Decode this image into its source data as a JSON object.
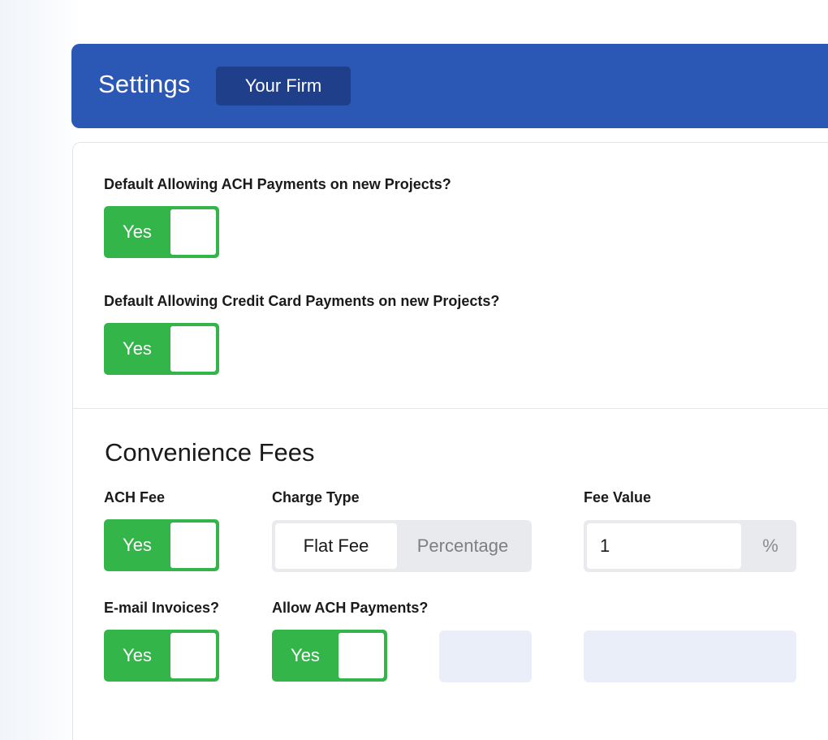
{
  "header": {
    "title": "Settings",
    "tab": "Your Firm"
  },
  "defaults": {
    "ach_question": "Default Allowing ACH Payments on new Projects?",
    "ach_toggle": "Yes",
    "cc_question": "Default Allowing Credit Card Payments on new Projects?",
    "cc_toggle": "Yes"
  },
  "convenience_fees": {
    "title": "Convenience Fees",
    "ach_fee_label": "ACH Fee",
    "ach_fee_toggle": "Yes",
    "charge_type_label": "Charge Type",
    "charge_type_options": [
      "Flat Fee",
      "Percentage"
    ],
    "charge_type_selected": "Flat Fee",
    "fee_value_label": "Fee Value",
    "fee_value": "1",
    "fee_unit": "%",
    "email_invoices_label": "E-mail Invoices?",
    "email_invoices_toggle": "Yes",
    "allow_ach_label": "Allow ACH Payments?",
    "allow_ach_toggle": "Yes"
  },
  "colors": {
    "header_bg": "#2b57b5",
    "tab_bg": "#1f3f8a",
    "toggle_on": "#33b54a",
    "segment_bg": "#e8eaed",
    "placeholder_block": "#e9eef8"
  }
}
